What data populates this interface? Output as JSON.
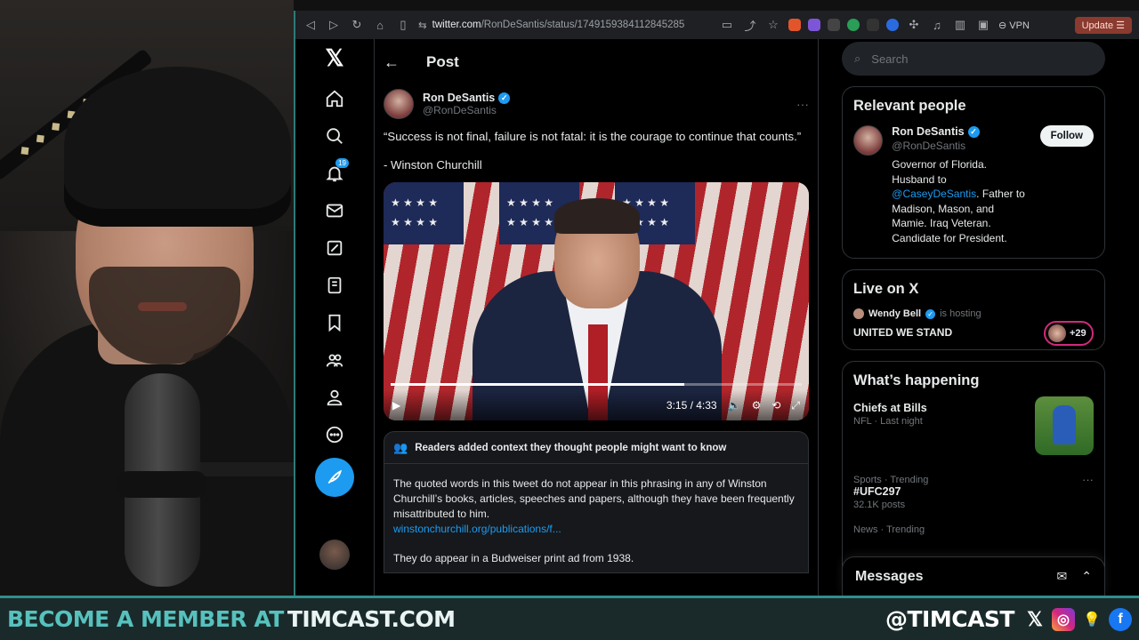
{
  "browser": {
    "url_domain": "twitter.com",
    "url_path": "/RonDeSantis/status/1749159384112845285",
    "vpn_label": "⊖ VPN",
    "update_label": "Update"
  },
  "nav": {
    "notification_count": "19"
  },
  "post": {
    "header_title": "Post",
    "back_arrow": "←",
    "author_name": "Ron DeSantis",
    "author_handle": "@RonDeSantis",
    "more": "···",
    "text": "“Success is not final, failure is not fatal: it is the courage to continue that counts.”",
    "attribution": "- Winston Churchill",
    "video": {
      "time": "3:15 / 4:33",
      "progress_fraction": 0.714
    },
    "context": {
      "heading": "Readers added context they thought people might want to know",
      "body": "The quoted words in this tweet do not appear in this phrasing in any of Winston Churchill’s books, articles, speeches and papers, although they have been frequently misattributed to him.",
      "link": "winstonchurchill.org/publications/f...",
      "body2": "They do appear in a Budweiser print ad from 1938."
    }
  },
  "sidebar": {
    "search_placeholder": "Search",
    "relevant_people": {
      "title": "Relevant people",
      "name": "Ron DeSantis",
      "handle": "@RonDeSantis",
      "follow_label": "Follow",
      "bio_before": "Governor of Florida. Husband to ",
      "bio_mention": "@CaseyDeSantis",
      "bio_after": ". Father to Madison, Mason, and Mamie. Iraq Veteran. Candidate for President."
    },
    "live": {
      "title": "Live on X",
      "host": "Wendy Bell",
      "hosting": "is hosting",
      "space_title": "UNITED WE STAND",
      "listeners": "+29"
    },
    "happening": {
      "title": "What’s happening",
      "trends": [
        {
          "meta": "",
          "name": "Chiefs at Bills",
          "count": "NFL · Last night"
        },
        {
          "meta": "Sports · Trending",
          "name": "#UFC297",
          "count": "32.1K posts"
        },
        {
          "meta": "News · Trending",
          "name": "",
          "count": ""
        }
      ]
    },
    "messages_title": "Messages"
  },
  "banner": {
    "cta": "BECOME A MEMBER AT",
    "site": "TIMCAST.COM",
    "handle": "@TIMCAST"
  },
  "colors": {
    "x_blue": "#1d9bf0",
    "banner_teal": "#57c1bd",
    "background": "#000000"
  }
}
